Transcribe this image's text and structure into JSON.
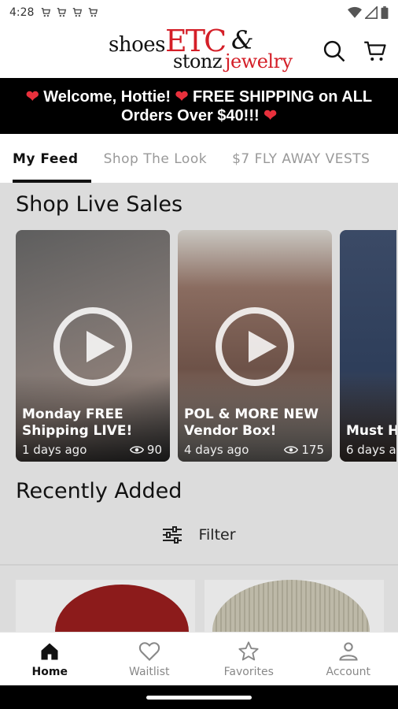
{
  "status_bar": {
    "time": "4:28"
  },
  "header": {
    "logo": {
      "shoes": "shoes",
      "etc": "ETC",
      "amp": "&",
      "stonz": "stonz",
      "jewelry": "jewelry"
    }
  },
  "banner": {
    "line1": "Welcome, Hottie!",
    "line1_after": "FREE SHIPPING on ALL",
    "line2": "Orders Over $40!!!",
    "heart": "❤",
    "heart_color": "#e8303c"
  },
  "tabs": [
    {
      "label": "My Feed",
      "active": true
    },
    {
      "label": "Shop The Look",
      "active": false
    },
    {
      "label": "$7 FLY AWAY VESTS",
      "active": false
    }
  ],
  "live_sales": {
    "title": "Shop Live Sales",
    "cards": [
      {
        "title": "Monday FREE Shipping LIVE!",
        "date": "1 days ago",
        "views": "90"
      },
      {
        "title": "POL & MORE NEW Vendor Box!",
        "date": "4 days ago",
        "views": "175"
      },
      {
        "title": "Must H",
        "date": "6 days a",
        "views": ""
      }
    ]
  },
  "recently_added": {
    "title": "Recently Added",
    "filter_label": "Filter"
  },
  "bottom_nav": [
    {
      "label": "Home",
      "icon": "home-icon",
      "active": true
    },
    {
      "label": "Waitlist",
      "icon": "heart-icon",
      "active": false
    },
    {
      "label": "Favorites",
      "icon": "star-icon",
      "active": false
    },
    {
      "label": "Account",
      "icon": "person-icon",
      "active": false
    }
  ],
  "colors": {
    "brand_red": "#d41f28",
    "banner_bg": "#000000"
  }
}
